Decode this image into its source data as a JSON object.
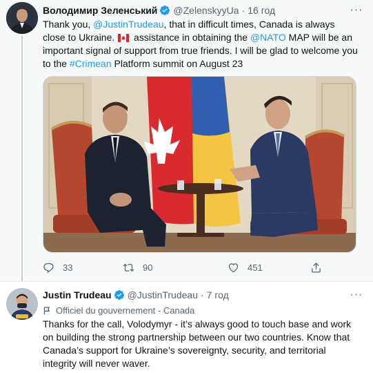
{
  "tweets": [
    {
      "author": {
        "name": "Володимир Зеленський",
        "handle": "@ZelenskyyUa",
        "verified": true
      },
      "separator": "·",
      "time": "16 год",
      "more_label": "···",
      "text": {
        "p1": "Thank you, ",
        "mention1": "@JustinTrudeau",
        "p2": ", that in difficult times, Canada is always close to Ukraine. ",
        "p3": " assistance in obtaining the ",
        "mention2": "@NATO",
        "p4": " MAP will be an important signal of support from true friends. I will be glad to welcome you to the ",
        "hashtag": "#Crimean",
        "p5": " Platform summit on August 23"
      },
      "flag_icon": "canada-flag-emoji",
      "media_alt": "Photo of Volodymyr Zelensky and Justin Trudeau seated in armchairs in front of Canadian and Ukrainian flags",
      "actions": {
        "reply_count": "33",
        "retweet_count": "90",
        "like_count": "451"
      }
    },
    {
      "author": {
        "name": "Justin Trudeau",
        "handle": "@JustinTrudeau",
        "verified": true
      },
      "separator": "·",
      "time": "7 год",
      "more_label": "···",
      "label": "Officiel du gouvernement - Canada",
      "text": "Thanks for the call, Volodymyr - it’s always good to touch base and work on building the strong partnership between our two countries. Know that Canada’s support for Ukraine’s sovereignty, security, and territorial integrity will never waver."
    }
  ],
  "colors": {
    "link": "#1d9bf0",
    "verified": "#1d9bf0",
    "secondary_text": "#536471",
    "focus_background": "#f7f9f9"
  }
}
